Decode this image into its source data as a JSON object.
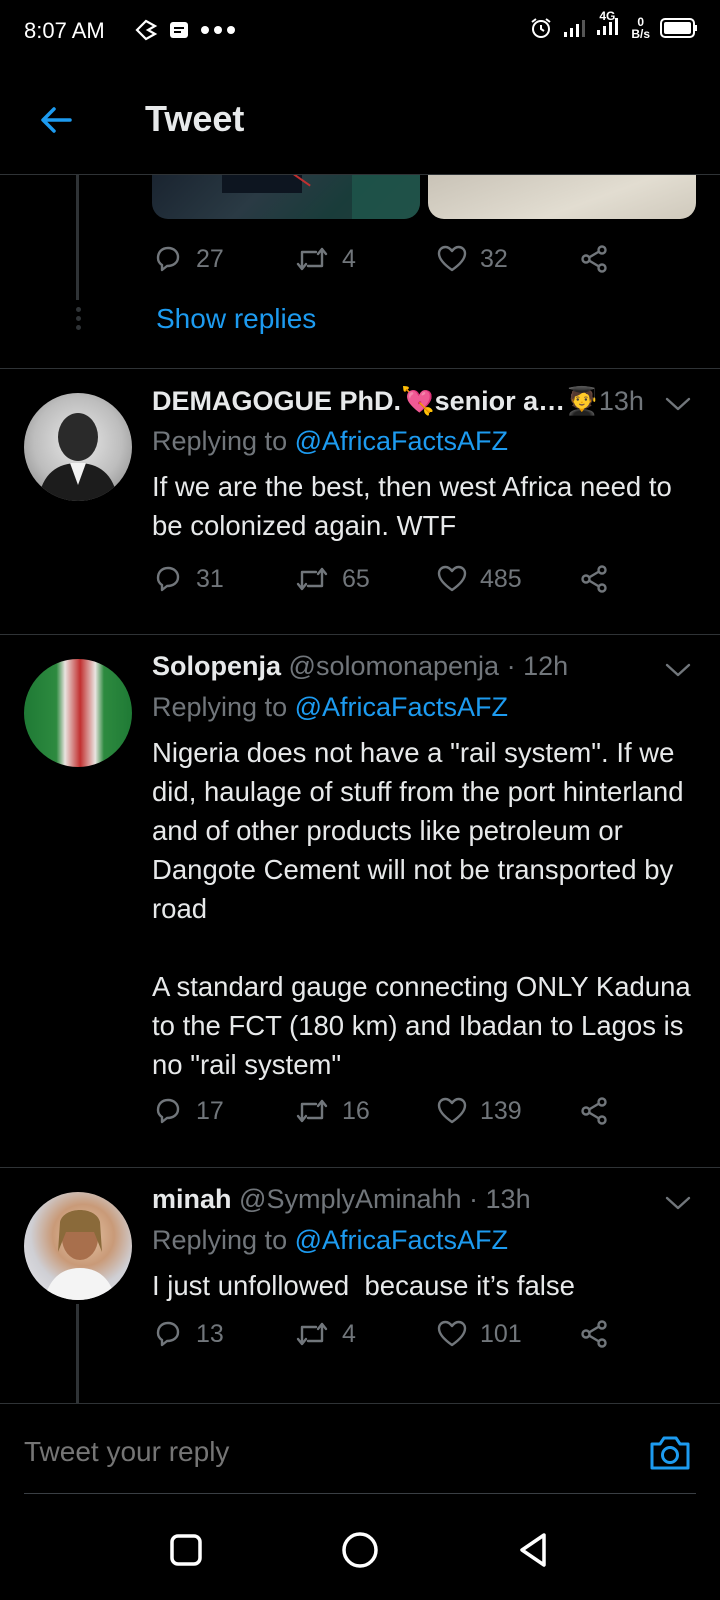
{
  "status_bar": {
    "time": "8:07 AM",
    "network": "4G",
    "speed_value": "0",
    "speed_unit": "B/s"
  },
  "header": {
    "title": "Tweet"
  },
  "first_tweet": {
    "replies": "27",
    "retweets": "4",
    "likes": "32",
    "show_replies": "Show replies"
  },
  "tweets": [
    {
      "name": "DEMAGOGUE PhD.",
      "name_emoji_1": "💘",
      "name_suffix": "senior a…",
      "name_emoji_2": "🧑‍🎓",
      "handle": "",
      "time": "13h",
      "replying_prefix": "Replying to ",
      "replying_to": "@AfricaFactsAFZ",
      "text": "If we are the best, then west Africa need to be colonized again. WTF",
      "replies": "31",
      "retweets": "65",
      "likes": "485"
    },
    {
      "name": "Solopenja",
      "handle": "@solomonapenja",
      "time": "· 12h",
      "replying_prefix": "Replying to ",
      "replying_to": "@AfricaFactsAFZ",
      "text": "Nigeria does not have a \"rail system\". If we did, haulage of stuff from the port hinterland and of other products like petroleum or Dangote Cement will not be transported by road\n\nA standard gauge connecting ONLY Kaduna to the FCT (180 km) and Ibadan to Lagos is no \"rail system\"",
      "replies": "17",
      "retweets": "16",
      "likes": "139"
    },
    {
      "name": "minah",
      "handle": "@SymplyAminahh",
      "time": "· 13h",
      "replying_prefix": "Replying to ",
      "replying_to": "@AfricaFactsAFZ",
      "text": "I just unfollowed  because it’s false",
      "replies": "13",
      "retweets": "4",
      "likes": "101"
    }
  ],
  "reply_bar": {
    "placeholder": "Tweet your reply"
  },
  "colors": {
    "background": "#000000",
    "accent": "#1d9bf0",
    "muted": "#71767b",
    "text": "#e7e9ea",
    "divider": "#2f3336"
  },
  "icons": [
    "back-arrow-icon",
    "reply-icon",
    "retweet-icon",
    "like-icon",
    "share-icon",
    "chevron-down-icon",
    "camera-icon",
    "alarm-icon",
    "signal-icon",
    "battery-icon",
    "nav-square-icon",
    "nav-circle-icon",
    "nav-back-triangle-icon"
  ]
}
